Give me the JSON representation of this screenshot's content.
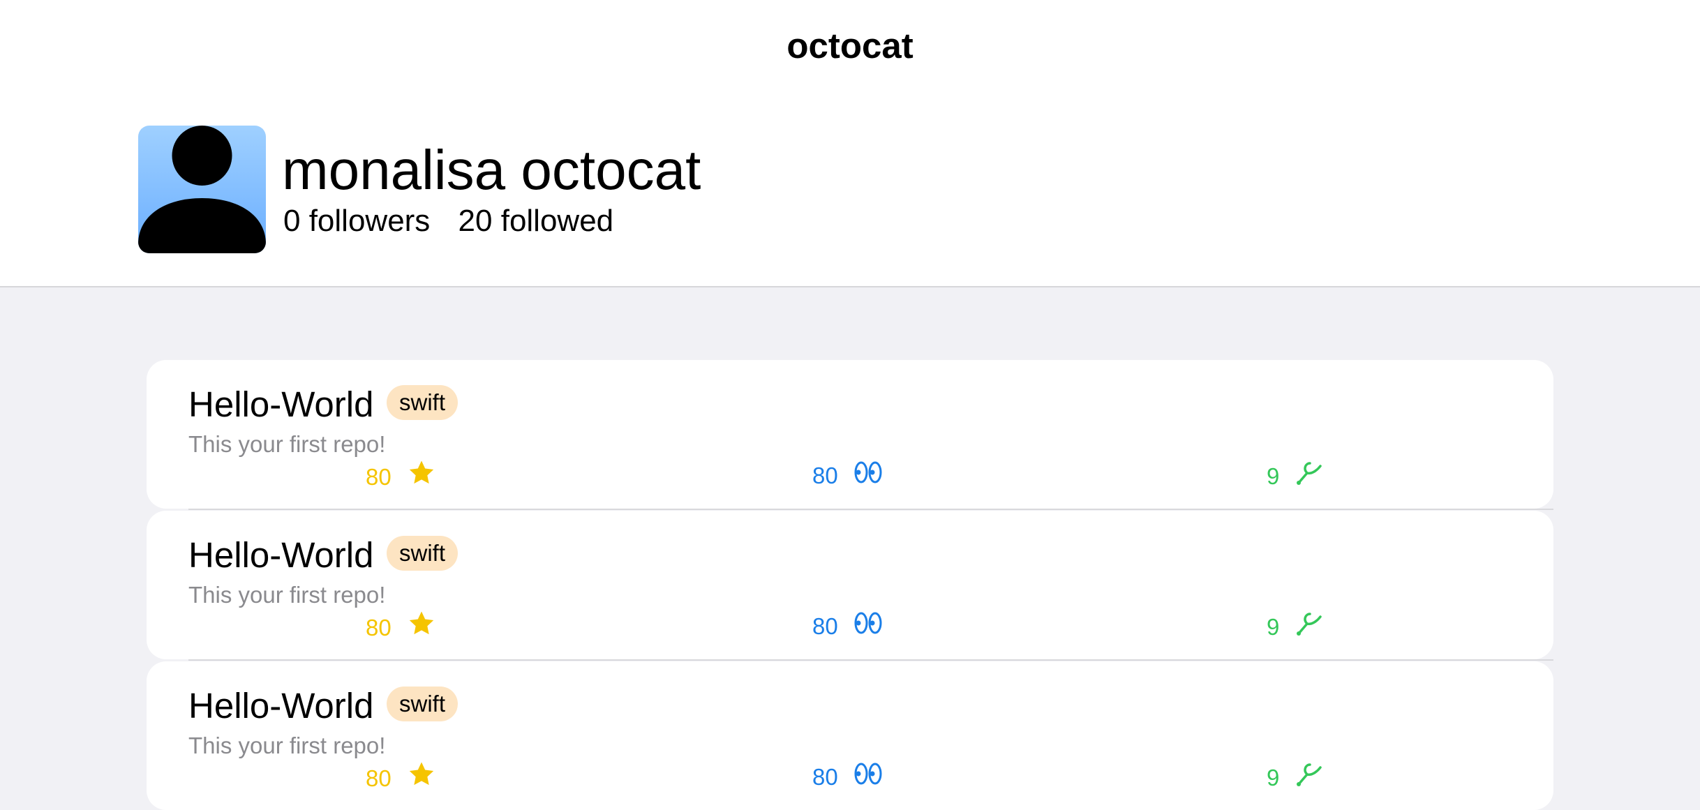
{
  "nav": {
    "title": "octocat"
  },
  "profile": {
    "name": "monalisa octocat",
    "followers": "0 followers",
    "followed": "20 followed"
  },
  "repos": [
    {
      "name": "Hello-World",
      "language": "swift",
      "description": "This your first repo!",
      "stars": "80",
      "watchers": "80",
      "forks": "9"
    },
    {
      "name": "Hello-World",
      "language": "swift",
      "description": "This your first repo!",
      "stars": "80",
      "watchers": "80",
      "forks": "9"
    },
    {
      "name": "Hello-World",
      "language": "swift",
      "description": "This your first repo!",
      "stars": "80",
      "watchers": "80",
      "forks": "9"
    }
  ],
  "icons": {
    "star": "star-icon",
    "watchers": "eyes-icon",
    "forks": "tuning-fork-icon"
  },
  "colors": {
    "background": "#f1f1f5",
    "stars": "#f5c400",
    "watchers": "#1a7ee8",
    "forks": "#34c759",
    "badge": "#fde4c2",
    "description": "#8a8a8e"
  }
}
